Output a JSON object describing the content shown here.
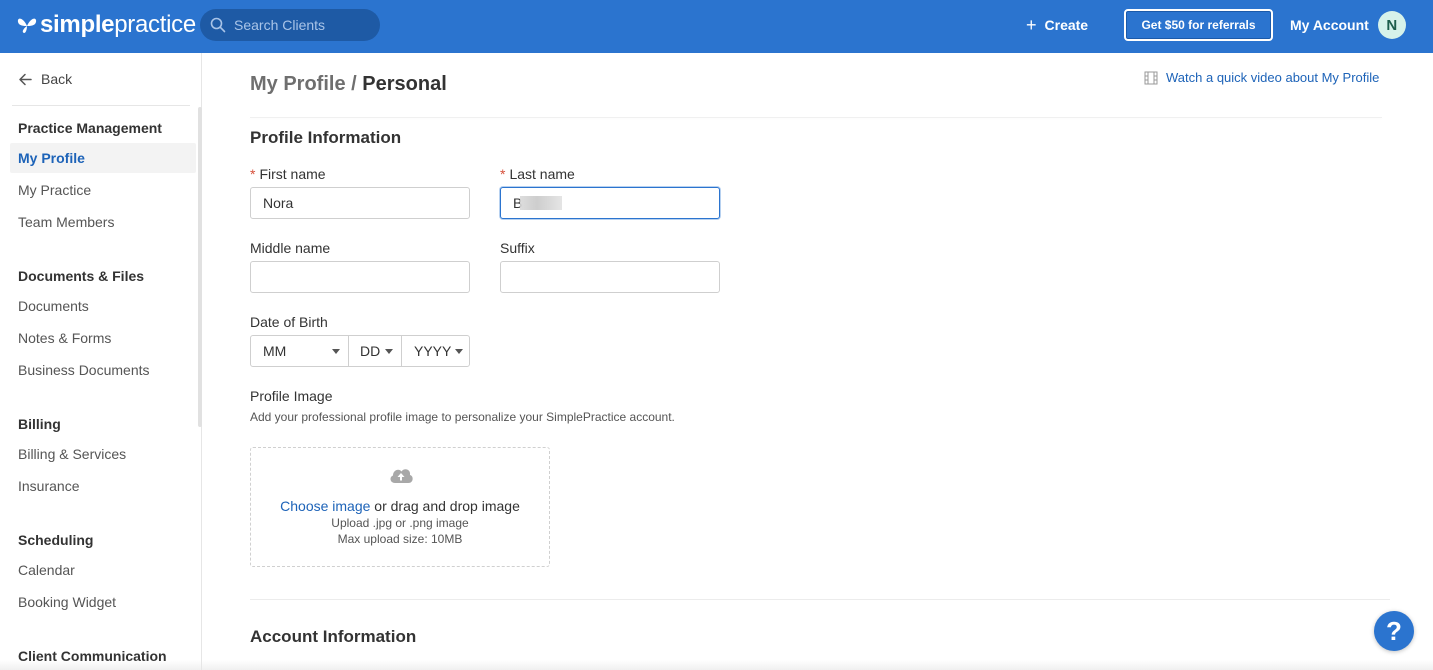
{
  "header": {
    "brand_bold": "simple",
    "brand_light": "practice",
    "search_placeholder": "Search Clients",
    "create_label": "Create",
    "referral_label": "Get $50 for referrals",
    "account_label": "My Account",
    "avatar_initial": "N",
    "brand_color": "#2b74cf"
  },
  "sidebar": {
    "back_label": "Back",
    "groups": [
      {
        "title": "Practice Management",
        "items": [
          "My Profile",
          "My Practice",
          "Team Members"
        ]
      },
      {
        "title": "Documents & Files",
        "items": [
          "Documents",
          "Notes & Forms",
          "Business Documents"
        ]
      },
      {
        "title": "Billing",
        "items": [
          "Billing & Services",
          "Insurance"
        ]
      },
      {
        "title": "Scheduling",
        "items": [
          "Calendar",
          "Booking Widget"
        ]
      },
      {
        "title": "Client Communication",
        "items": []
      }
    ],
    "active_item": "My Profile"
  },
  "main": {
    "breadcrumb_parent": "My Profile /",
    "breadcrumb_current": "Personal",
    "video_link": "Watch a quick video about My Profile",
    "profile_section_title": "Profile Information",
    "fields": {
      "first_name": {
        "label": "First name",
        "value": "Nora",
        "required": "*"
      },
      "last_name": {
        "label": "Last name",
        "value": "B",
        "required": "*"
      },
      "middle_name": {
        "label": "Middle name",
        "value": ""
      },
      "suffix": {
        "label": "Suffix",
        "value": ""
      }
    },
    "dob": {
      "label": "Date of Birth",
      "month": "MM",
      "day": "DD",
      "year": "YYYY"
    },
    "profile_image": {
      "label": "Profile Image",
      "hint": "Add your professional profile image to personalize your SimplePractice account.",
      "choose_link": "Choose image",
      "drag_text": " or drag and drop image",
      "formats": "Upload .jpg or .png image",
      "max_size": "Max upload size: 10MB"
    },
    "account_section_title": "Account Information"
  },
  "help_label": "?"
}
